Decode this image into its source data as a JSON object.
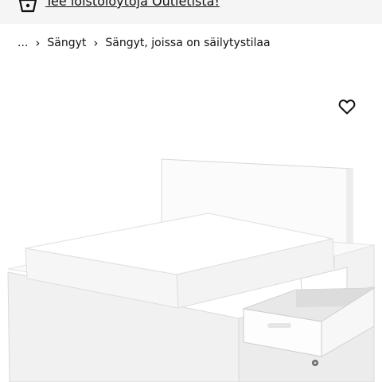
{
  "banner": {
    "link_text": "Tee löistölöytöjä Outletista!",
    "icon": "basket-icon"
  },
  "breadcrumb": {
    "items": [
      "...",
      "Sängyt",
      "Sängyt, joissa on säilytystilaa"
    ],
    "separator": "›"
  },
  "product": {
    "wishlist_icon": "heart-outline-icon",
    "image_subject": "white bed frame with pull-out storage drawers"
  },
  "colors": {
    "banner_bg": "#f5f5f5",
    "text": "#111111"
  }
}
